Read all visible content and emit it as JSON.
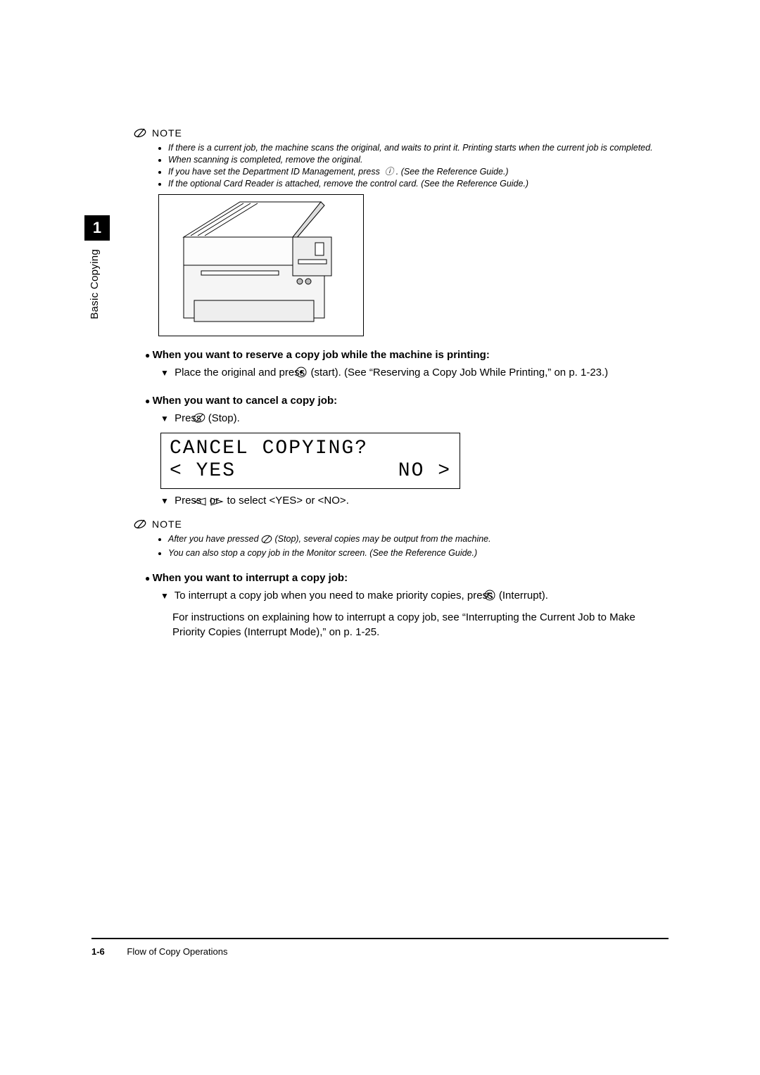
{
  "sidebar": {
    "chapter_number": "1",
    "chapter_title": "Basic Copying"
  },
  "note_label": "NOTE",
  "note1": {
    "items": [
      "If there is a current job, the machine scans the original, and waits to print it. Printing starts when the current job is completed.",
      "When scanning is completed, remove the original.",
      "If you have set the Department ID Management, press  ⓘ . (See the Reference Guide.)",
      "If the optional Card Reader is attached, remove the control card. (See the Reference Guide.)"
    ]
  },
  "sec_reserve": {
    "heading": "When you want to reserve a copy job while the machine is printing:",
    "line_pre": "Place the original and press ",
    "line_post": " (start). (See “Reserving a Copy Job While Printing,” on p. 1-23.)"
  },
  "sec_cancel": {
    "heading": "When you want to cancel a copy job:",
    "press_pre": "Press ",
    "press_post": " (Stop).",
    "lcd_line1": "CANCEL COPYING?",
    "lcd_yes": "< YES",
    "lcd_no": "NO >",
    "select_pre": "Press ",
    "select_mid": " or ",
    "select_post": " to select <YES> or <NO>."
  },
  "note2": {
    "items": [
      "After you have pressed  (Stop), several copies may be output from the machine.",
      "You can also stop a copy job in the Monitor screen. (See the Reference Guide.)"
    ]
  },
  "sec_interrupt": {
    "heading": "When you want to interrupt a copy job:",
    "line_pre": "To interrupt a copy job when you need to make priority copies, press ",
    "line_post": " (Interrupt).",
    "body": "For instructions on explaining how to interrupt a copy job, see “Interrupting the Current Job to Make Priority Copies (Interrupt Mode),” on p. 1-25."
  },
  "footer": {
    "page": "1-6",
    "title": "Flow of Copy Operations"
  }
}
